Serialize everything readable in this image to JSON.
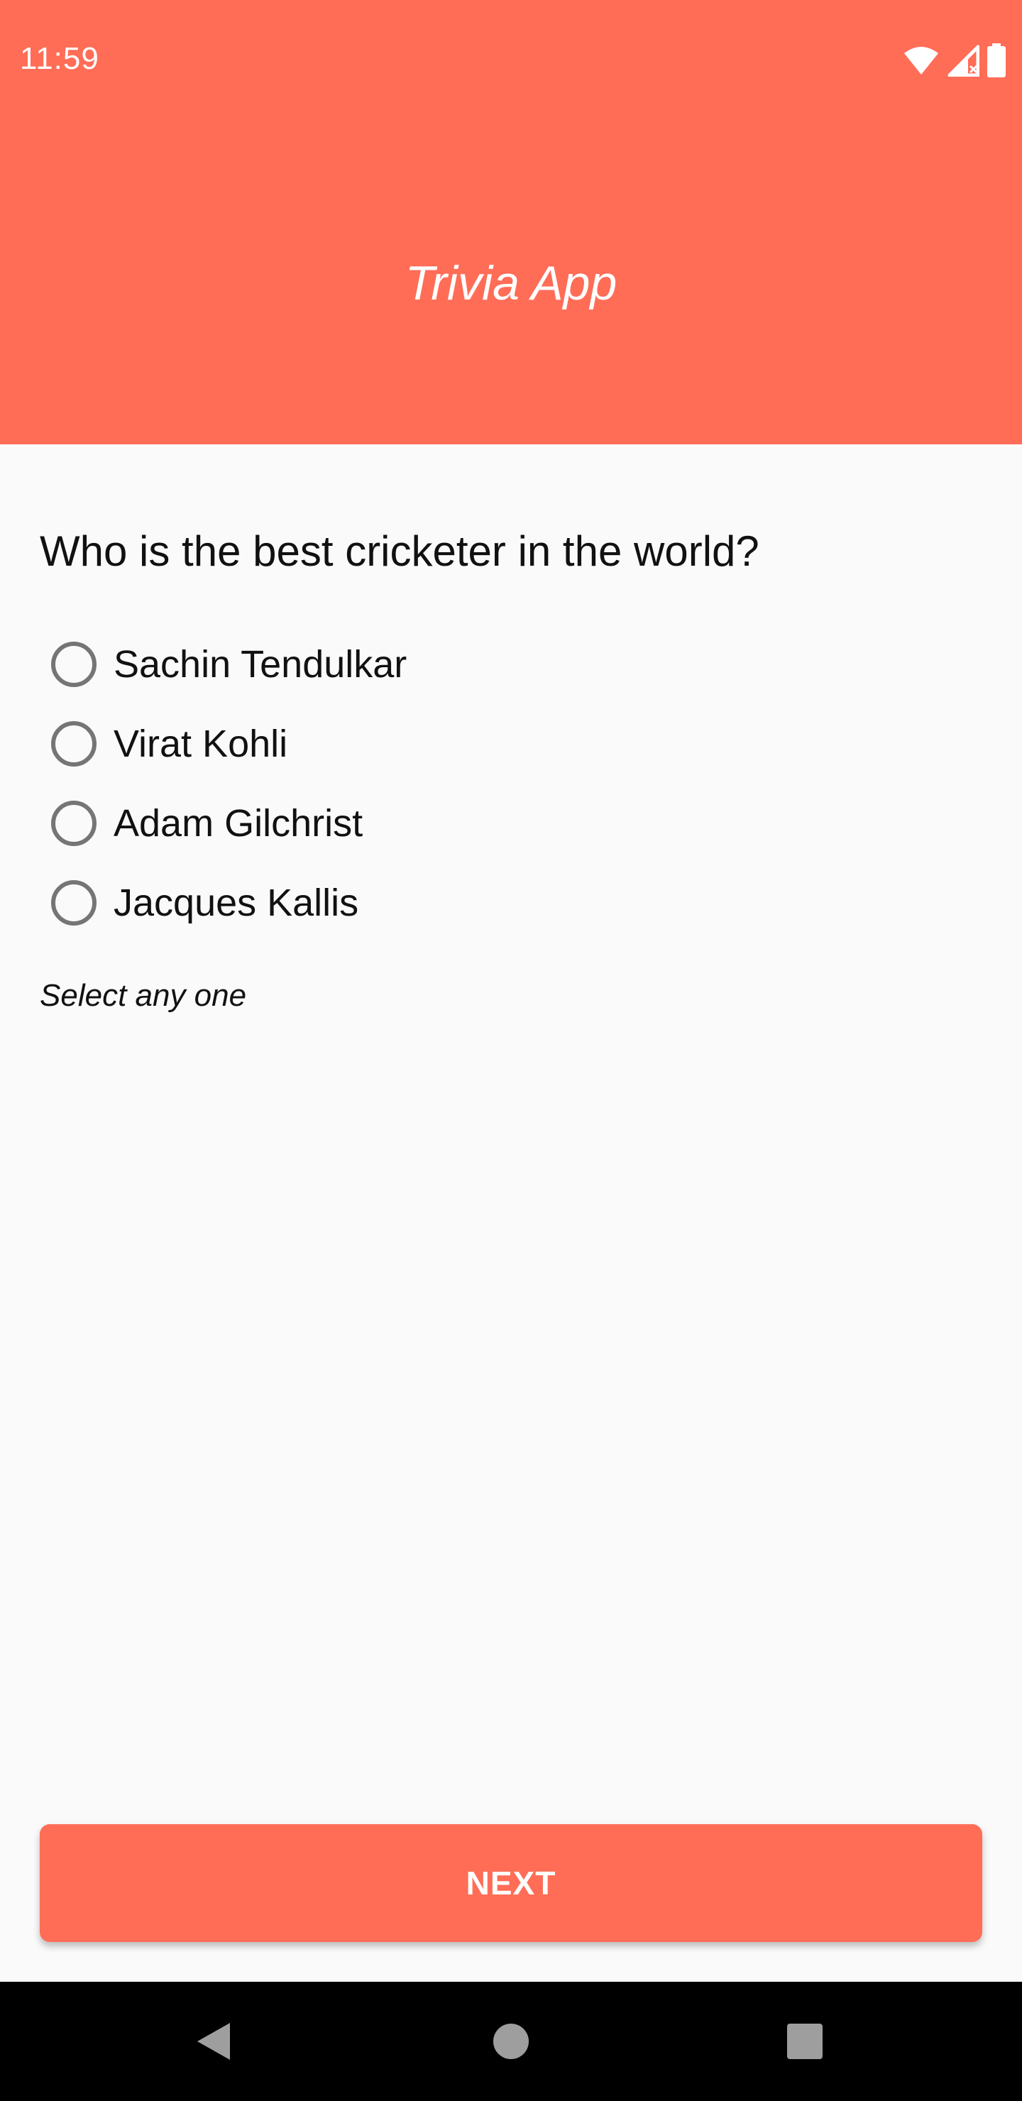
{
  "status_bar": {
    "time": "11:59",
    "icons": [
      "wifi-icon",
      "cellular-signal-icon",
      "battery-icon"
    ]
  },
  "app_bar": {
    "title": "Trivia App"
  },
  "quiz": {
    "question": "Who is the best cricketer in the world?",
    "options": [
      {
        "label": "Sachin Tendulkar",
        "selected": false
      },
      {
        "label": "Virat Kohli",
        "selected": false
      },
      {
        "label": "Adam Gilchrist",
        "selected": false
      },
      {
        "label": "Jacques Kallis",
        "selected": false
      }
    ],
    "hint": "Select any one"
  },
  "actions": {
    "next_label": "NEXT"
  },
  "navigation_bar": {
    "buttons": [
      "back-icon",
      "home-icon",
      "recents-icon"
    ]
  },
  "colors": {
    "accent": "#ff6d57",
    "background": "#fafafa",
    "radio_border": "#757575",
    "nav_bar": "#000000"
  }
}
